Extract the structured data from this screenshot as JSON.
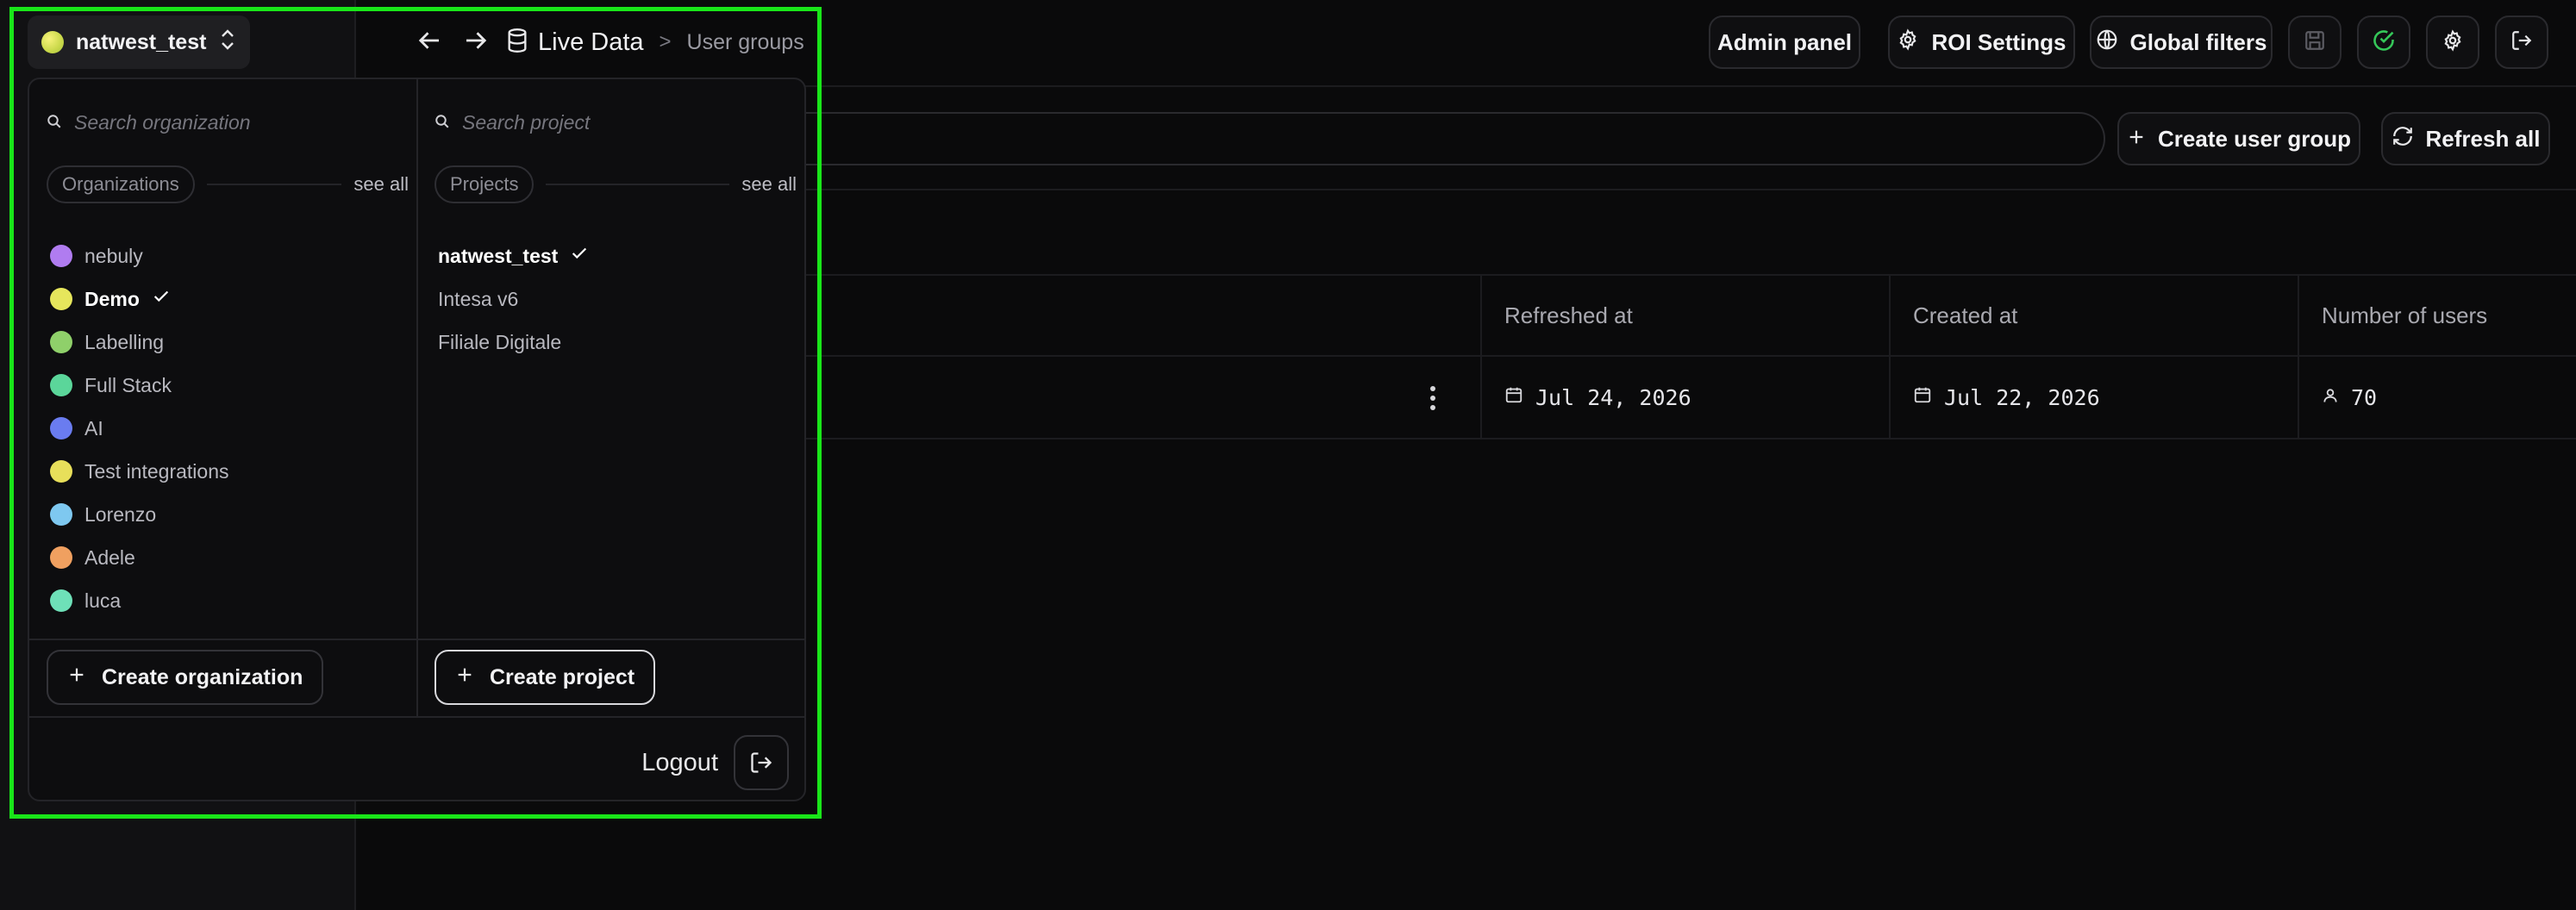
{
  "header": {
    "current_org": "natwest_test",
    "breadcrumb": {
      "root": "Live Data",
      "separator": ">",
      "current": "User groups"
    },
    "buttons": {
      "admin_panel": "Admin panel",
      "roi_settings": "ROI Settings",
      "global_filters": "Global filters"
    }
  },
  "toolbar": {
    "create_user_group": "Create user group",
    "refresh_all": "Refresh all"
  },
  "table": {
    "columns": [
      "Refreshed at",
      "Created at",
      "Number of users"
    ],
    "rows": [
      {
        "refreshed_at": "Jul 24, 2026",
        "created_at": "Jul 22, 2026",
        "users": "70"
      }
    ]
  },
  "dropdown": {
    "orgs": {
      "search_placeholder": "Search organization",
      "section_label": "Organizations",
      "see_all": "see all",
      "items": [
        {
          "label": "nebuly",
          "color": "#b07cf0"
        },
        {
          "label": "Demo",
          "color": "#e6e65c",
          "selected": true
        },
        {
          "label": "Labelling",
          "color": "#8fd06a"
        },
        {
          "label": "Full Stack",
          "color": "#5bd69a"
        },
        {
          "label": "AI",
          "color": "#6a7cf0"
        },
        {
          "label": "Test integrations",
          "color": "#e8df5a"
        },
        {
          "label": "Lorenzo",
          "color": "#7ec8f0"
        },
        {
          "label": "Adele",
          "color": "#f0a060"
        },
        {
          "label": "luca",
          "color": "#6ee0b8"
        }
      ],
      "create_label": "Create organization"
    },
    "projects": {
      "search_placeholder": "Search project",
      "section_label": "Projects",
      "see_all": "see all",
      "items": [
        {
          "label": "natwest_test",
          "selected": true
        },
        {
          "label": "Intesa v6"
        },
        {
          "label": "Filiale Digitale"
        }
      ],
      "create_label": "Create project"
    },
    "logout_label": "Logout"
  },
  "colors": {
    "highlight_frame": "#19e619",
    "success": "#35c759"
  }
}
